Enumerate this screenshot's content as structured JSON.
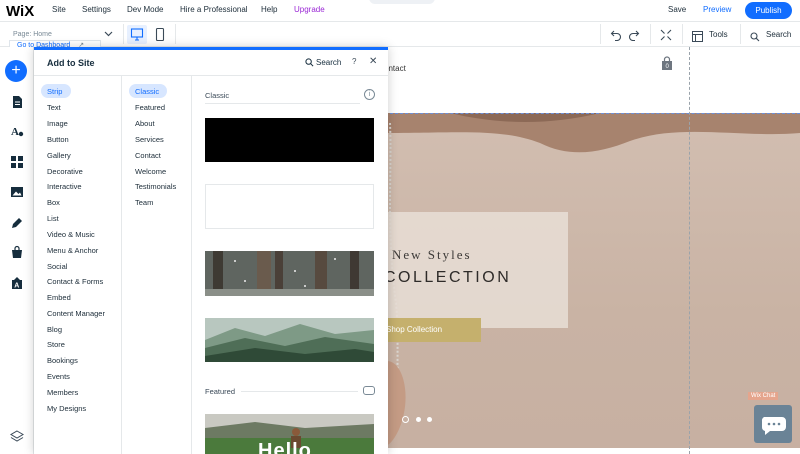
{
  "topbar": {
    "logo": "WiX",
    "menu": [
      "Site",
      "Settings",
      "Dev Mode",
      "Hire a Professional",
      "Help",
      "Upgrade"
    ],
    "save": "Save",
    "preview": "Preview",
    "publish": "Publish"
  },
  "secondbar": {
    "page_label": "Page: Home",
    "dashboard_link": "Go to Dashboard",
    "tools": "Tools",
    "search": "Search"
  },
  "panel": {
    "title": "Add to Site",
    "search": "Search",
    "help": "?",
    "close": "✕",
    "categories": [
      "Strip",
      "Text",
      "Image",
      "Button",
      "Gallery",
      "Decorative",
      "Interactive",
      "Box",
      "List",
      "Video & Music",
      "Menu & Anchor",
      "Social",
      "Contact & Forms",
      "Embed",
      "Content Manager",
      "Blog",
      "Store",
      "Bookings",
      "Events",
      "Members",
      "My Designs"
    ],
    "subcategories": [
      "Classic",
      "Featured",
      "About",
      "Services",
      "Contact",
      "Welcome",
      "Testimonials",
      "Team"
    ],
    "section_classic": "Classic",
    "section_featured": "Featured",
    "hello_text": "Hello"
  },
  "canvas": {
    "nav_contact": "ontact",
    "new_styles": "New Styles",
    "collection": "COLLECTION",
    "shop_button": "Shop Collection",
    "wix_chat": "Wix Chat"
  },
  "colors": {
    "accent": "#116dff",
    "upgrade": "#9a27d5",
    "shop_button": "#c5b06d"
  }
}
